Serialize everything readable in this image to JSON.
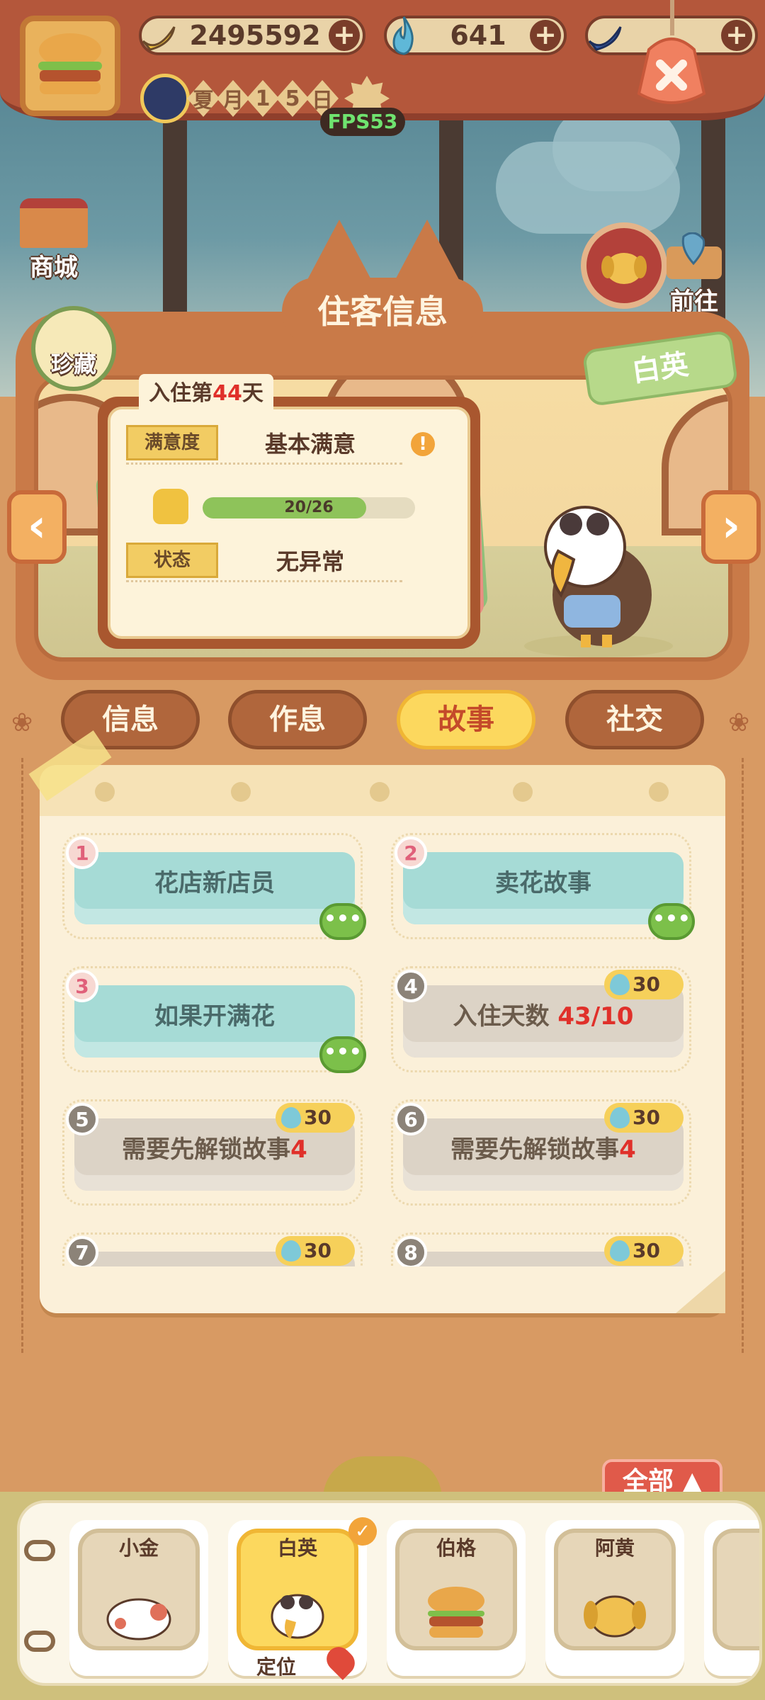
{
  "resources": {
    "banana": "2495592",
    "fire": "641",
    "blue_banana": ""
  },
  "date": {
    "chars": [
      "夏",
      "月",
      "1",
      "5",
      "日"
    ]
  },
  "fps": "FPS53",
  "side_buttons": {
    "shop": "商城",
    "collection": "珍藏",
    "goto": "前往"
  },
  "panel": {
    "title": "住客信息",
    "name_tag": "白英",
    "stay_prefix": "入住第",
    "stay_days": "44",
    "stay_suffix": "天",
    "satisfaction_label": "满意度",
    "satisfaction_value": "基本满意",
    "progress_text": "20/26",
    "progress_fraction": 0.77,
    "status_label": "状态",
    "status_value": "无异常"
  },
  "tabs": [
    {
      "label": "信息",
      "active": false
    },
    {
      "label": "作息",
      "active": false
    },
    {
      "label": "故事",
      "active": true
    },
    {
      "label": "社交",
      "active": false
    }
  ],
  "stories": [
    {
      "num": "1",
      "title": "花店新店员",
      "unlocked": true
    },
    {
      "num": "2",
      "title": "卖花故事",
      "unlocked": true
    },
    {
      "num": "3",
      "title": "如果开满花",
      "unlocked": true
    },
    {
      "num": "4",
      "title": "入住天数 ",
      "red": "43/10",
      "unlocked": false,
      "cost": "30"
    },
    {
      "num": "5",
      "title": "需要先解锁故事",
      "red": "4",
      "unlocked": false,
      "cost": "30"
    },
    {
      "num": "6",
      "title": "需要先解锁故事",
      "red": "4",
      "unlocked": false,
      "cost": "30"
    },
    {
      "num": "7",
      "title": "",
      "unlocked": false,
      "cost": "30"
    },
    {
      "num": "8",
      "title": "",
      "unlocked": false,
      "cost": "30"
    }
  ],
  "chat_glyph": "•••",
  "all_button": "全部",
  "residents": [
    {
      "name": "小金",
      "selected": false
    },
    {
      "name": "白英",
      "selected": true,
      "locate": "定位"
    },
    {
      "name": "伯格",
      "selected": false
    },
    {
      "name": "阿黄",
      "selected": false
    }
  ],
  "colors": {
    "accent": "#fcd85e",
    "highlight_red": "#e0302a",
    "story_unlocked": "#a6dbd6",
    "story_locked": "#dcd3c6"
  }
}
